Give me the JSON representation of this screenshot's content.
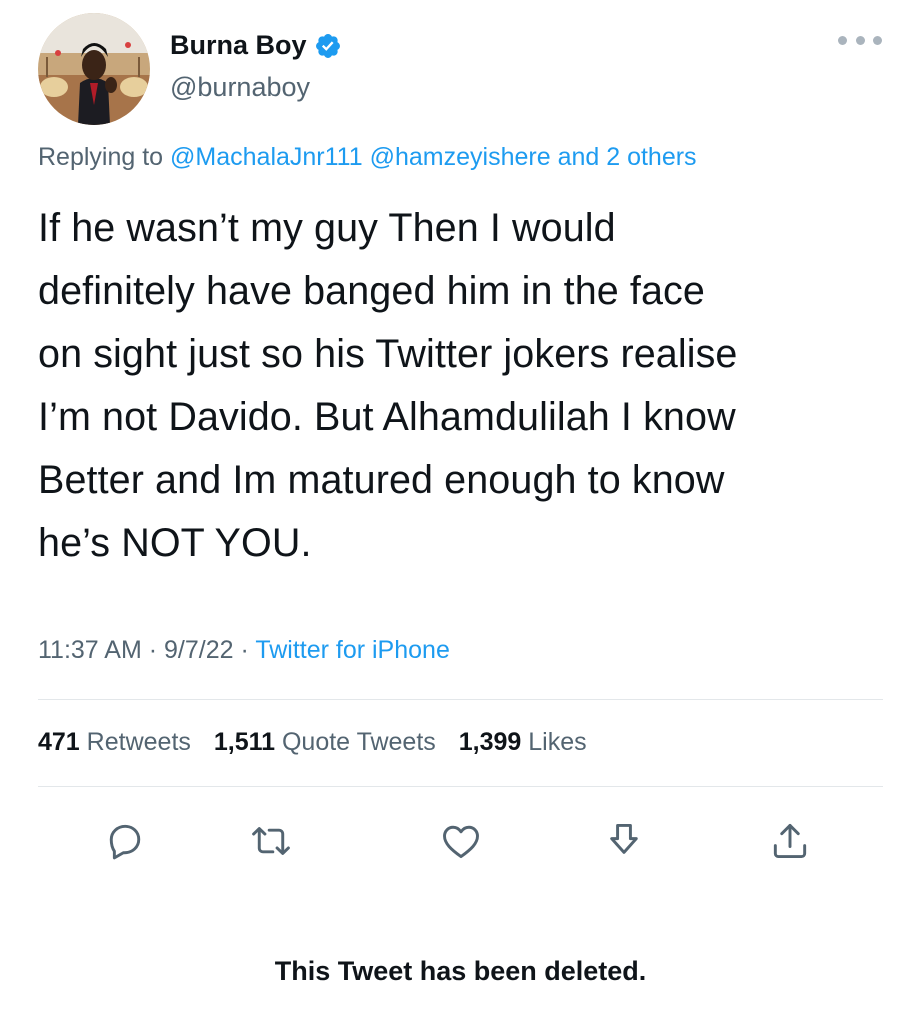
{
  "user": {
    "name": "Burna Boy",
    "handle": "@burnaboy",
    "avatar_icon": "profile-photo",
    "verified_icon": "verified-badge-icon"
  },
  "reply": {
    "prefix": "Replying to",
    "mention1": "@MachalaJnr111",
    "mention2": "@hamzeyishere",
    "others": "and 2 others"
  },
  "tweet": {
    "lines": [
      "If he wasn’t my guy Then I would",
      "definitely have banged him in the face",
      "on sight just so his Twitter jokers realise",
      "I’m not Davido. But Alhamdulilah I know",
      "Better and Im matured enough to know",
      "he’s NOT YOU."
    ]
  },
  "meta": {
    "time": "11:37 AM",
    "sep1": "·",
    "date": "9/7/22",
    "sep2": "·",
    "source": "Twitter for iPhone"
  },
  "stats": {
    "retweets_count": "471",
    "retweets_label": "Retweets",
    "quotes_count": "1,511",
    "quotes_label": "Quote Tweets",
    "likes_count": "1,399",
    "likes_label": "Likes"
  },
  "actions": [
    "reply-icon",
    "retweet-icon",
    "like-icon",
    "bookmark-icon",
    "share-icon"
  ],
  "footer": {
    "deleted_notice": "This Tweet has been deleted."
  },
  "colors": {
    "accent": "#1d9bf0",
    "secondary_text": "#536471",
    "primary_text": "#0f1419",
    "divider": "#e3e7ea"
  }
}
